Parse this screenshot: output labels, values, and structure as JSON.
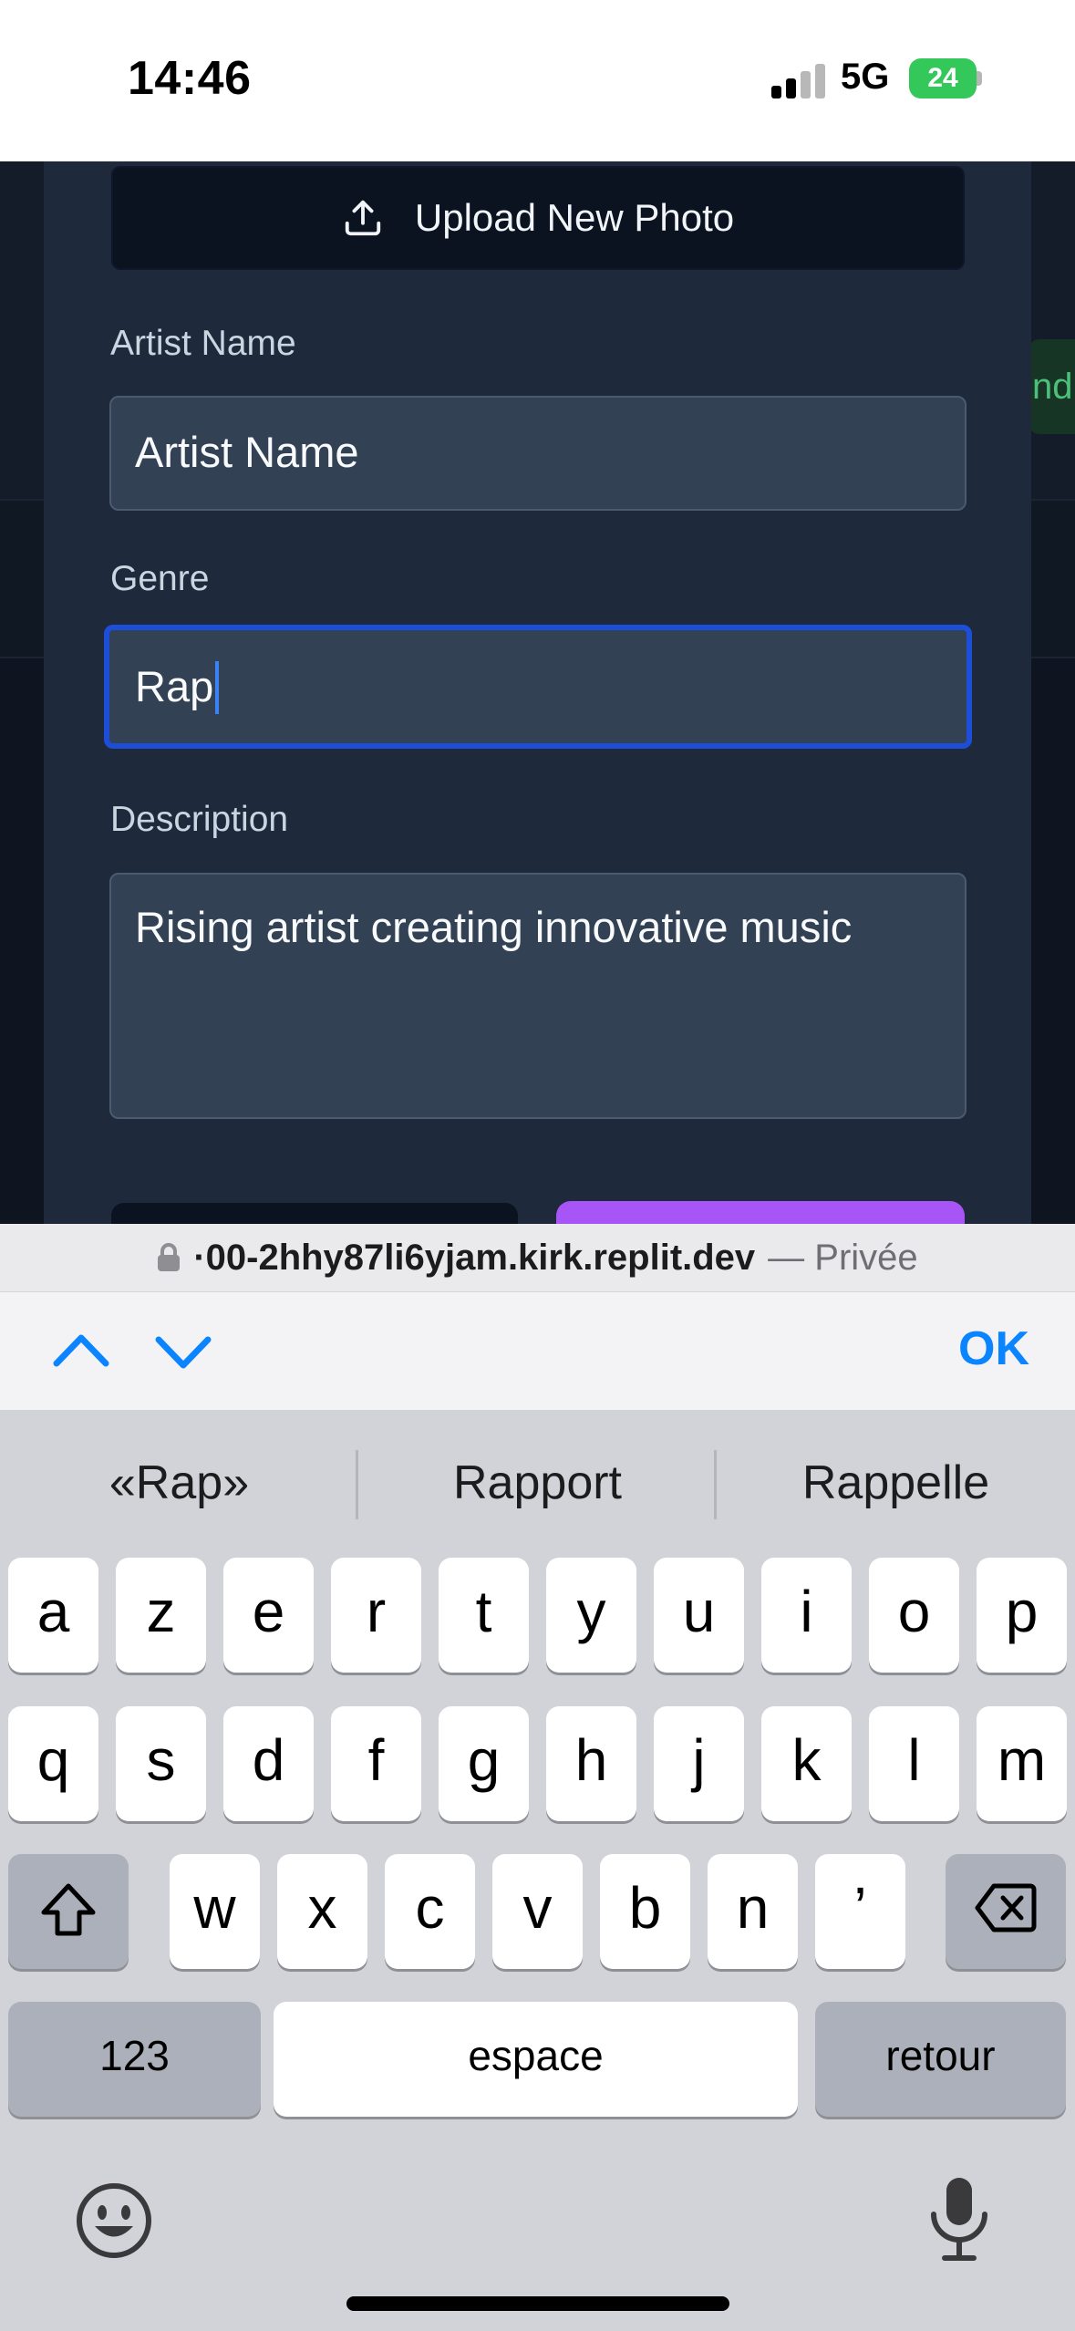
{
  "status_bar": {
    "time": "14:46",
    "network": "5G",
    "battery": "24"
  },
  "background": {
    "peek_text": "nd"
  },
  "form": {
    "upload_button": "Upload New Photo",
    "artist_name": {
      "label": "Artist Name",
      "value": "Artist Name"
    },
    "genre": {
      "label": "Genre",
      "value": "Rap"
    },
    "description": {
      "label": "Description",
      "value": "Rising artist creating innovative music"
    }
  },
  "browser": {
    "url": "·00-2hhy87li6yjam.kirk.replit.dev",
    "mode": "— Privée"
  },
  "accessory": {
    "ok_label": "OK"
  },
  "keyboard": {
    "suggestions": [
      "«Rap»",
      "Rapport",
      "Rappelle"
    ],
    "row1": [
      "a",
      "z",
      "e",
      "r",
      "t",
      "y",
      "u",
      "i",
      "o",
      "p"
    ],
    "row2": [
      "q",
      "s",
      "d",
      "f",
      "g",
      "h",
      "j",
      "k",
      "l",
      "m"
    ],
    "row3": [
      "w",
      "x",
      "c",
      "v",
      "b",
      "n",
      "’"
    ],
    "numbers_label": "123",
    "space_label": "espace",
    "return_label": "retour"
  },
  "colors": {
    "accent_focus": "#1d4ed8",
    "save_button": "#a855f7",
    "ios_blue": "#0a84ff",
    "battery": "#34c759"
  }
}
